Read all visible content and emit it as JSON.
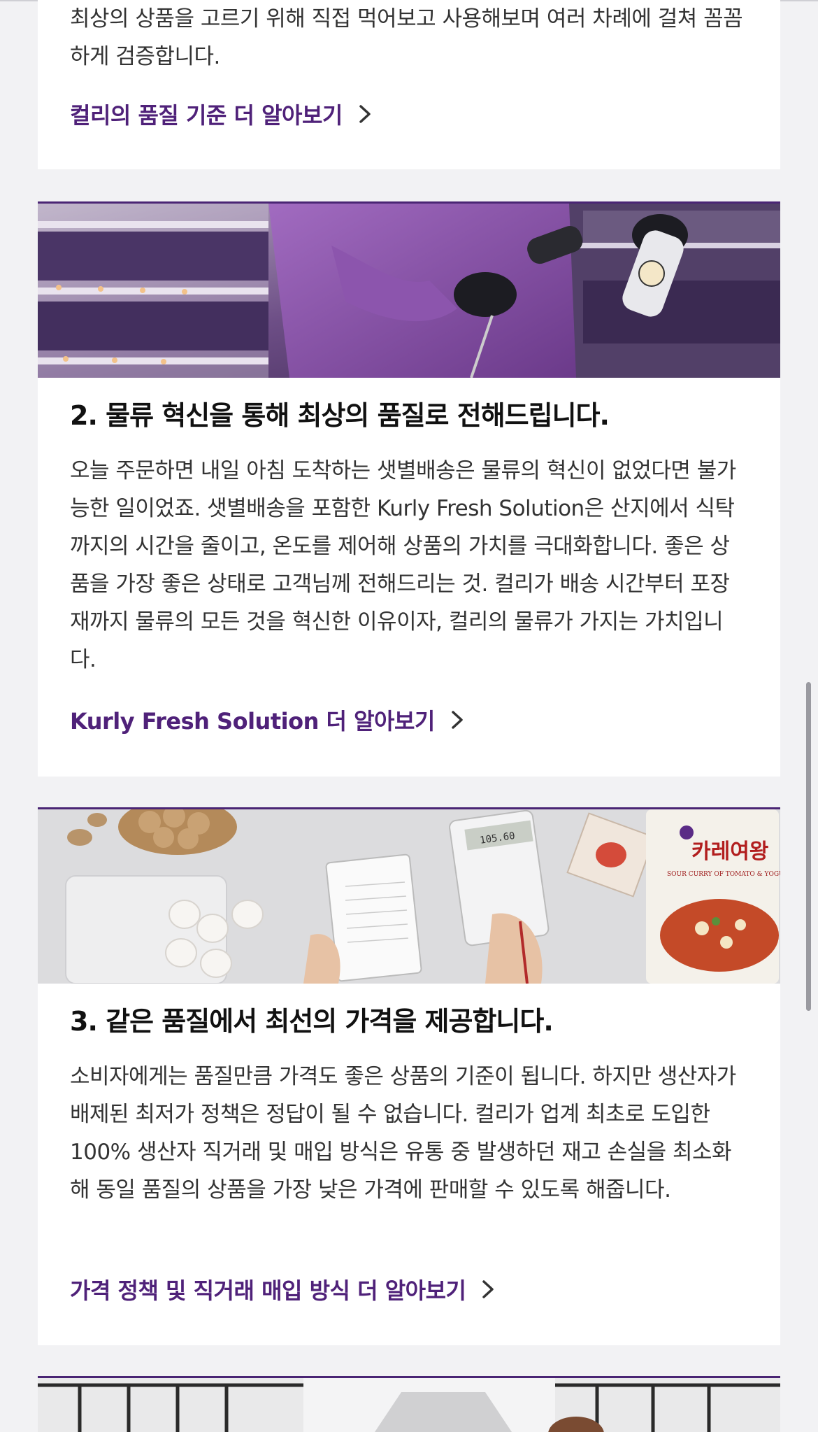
{
  "sections": [
    {
      "description": "최상의 상품을 고르기 위해 직접 먹어보고 사용해보며 여러 차례에 걸쳐 꼼꼼하게 검증합니다.",
      "link_label": "컬리의 품질 기준 더 알아보기"
    },
    {
      "title": "2. 물류 혁신을 통해 최상의 품질로 전해드립니다.",
      "description": "오늘 주문하면 내일 아침 도착하는 샛별배송은 물류의 혁신이 없었다면 불가능한 일이었죠. 샛별배송을 포함한 Kurly Fresh Solution은 산지에서 식탁까지의 시간을 줄이고, 온도를 제어해 상품의 가치를 극대화합니다. 좋은 상품을 가장 좋은 상태로 고객님께 전해드리는 것. 컬리가 배송 시간부터 포장재까지 물류의 모든 것을 혁신한 이유이자, 컬리의 물류가 가지는 가치입니다.",
      "link_label": "Kurly Fresh Solution 더 알아보기",
      "image_description": "warehouse worker scanning product"
    },
    {
      "title": "3. 같은 품질에서 최선의 가격을 제공합니다.",
      "description": "소비자에게는 품질만큼 가격도 좋은 상품의 기준이 됩니다. 하지만 생산자가 배제된 최저가 정책은 정답이 될 수 없습니다. 컬리가 업계 최초로 도입한 100% 생산자 직거래 및 매입 방식은 유통 중 발생하던 재고 손실을 최소화해 동일 품질의 상품을 가장 낮은 가격에 판매할 수 있도록 해줍니다.",
      "link_label": "가격 정책 및 직거래 매입 방식 더 알아보기",
      "image_description": "groceries with calculator and notebook",
      "product_text": "카레여왕",
      "product_subtext": "SOUR CURRY OF TOMATO & YOGURT",
      "calculator_display": "105.60"
    }
  ],
  "colors": {
    "brand_purple": "#4f2179",
    "card_border": "#4a2574",
    "page_background": "#f2f2f4"
  },
  "icons": {
    "link_arrow": "chevron-right-icon"
  }
}
